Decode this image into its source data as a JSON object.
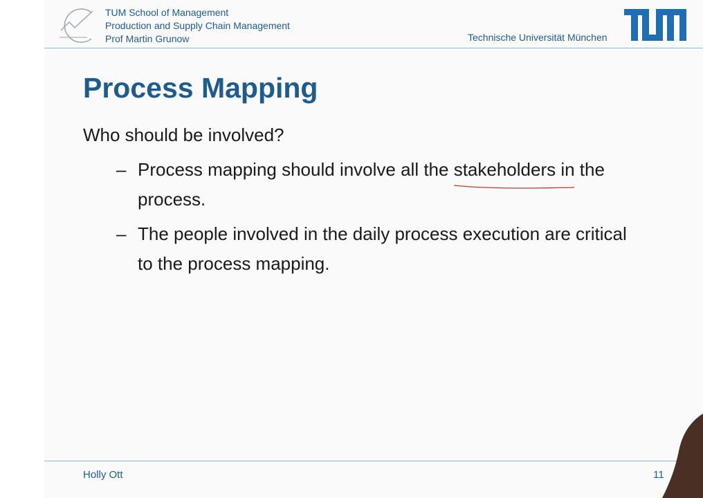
{
  "header": {
    "school": "TUM School of Management",
    "chair": "Production and Supply Chain Management",
    "professor": "Prof Martin Grunow",
    "university": "Technische Universität München",
    "logo_icon": "tum-logo-icon"
  },
  "slide": {
    "title": "Process Mapping",
    "question": "Who should be involved?",
    "bullets": {
      "b1_pre": "Process mapping should involve all the ",
      "b1_highlight": "stakeholders",
      "b1_post": " in the process.",
      "b2": "The people involved in the daily process execution are critical to the process mapping."
    },
    "dash": "–",
    "annotation_color": "#c0392b"
  },
  "footer": {
    "presenter": "Holly Ott",
    "page_number": "11"
  },
  "colors": {
    "accent": "#1f5c8e",
    "text": "#1a1a1a",
    "rule": "#8fb3cc"
  }
}
